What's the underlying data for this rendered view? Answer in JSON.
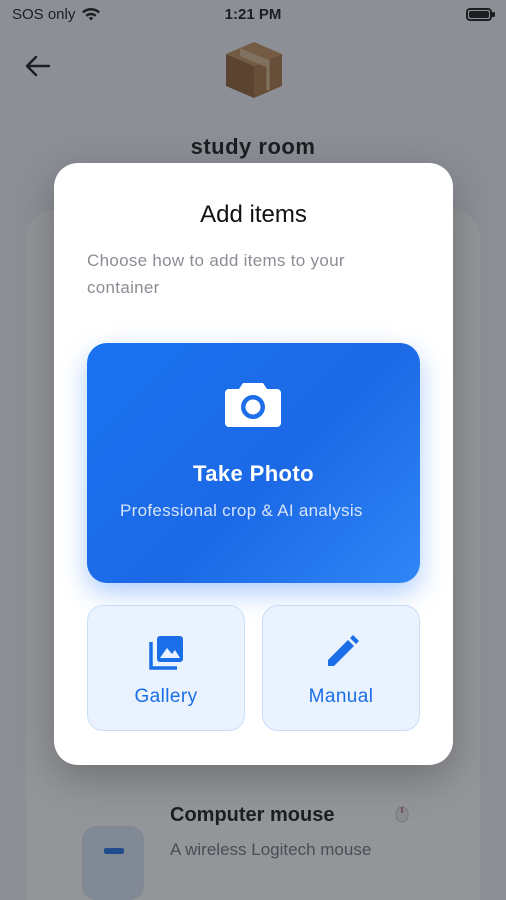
{
  "status_bar": {
    "carrier": "SOS only",
    "time": "1:21 PM"
  },
  "header": {
    "back_icon": "arrow-left-icon",
    "container_icon": "cardboard-box-icon",
    "title": "study room"
  },
  "background_item": {
    "name": "Computer mouse",
    "description": "A wireless Logitech mouse"
  },
  "dialog": {
    "title": "Add items",
    "subtitle": "Choose how to add items to your container",
    "take_photo": {
      "icon": "camera-icon",
      "label": "Take Photo",
      "description": "Professional crop & AI analysis"
    },
    "options": [
      {
        "icon": "gallery-icon",
        "label": "Gallery"
      },
      {
        "icon": "pencil-icon",
        "label": "Manual"
      }
    ]
  },
  "colors": {
    "accent": "#1a73f0",
    "option_bg": "#eaf2fe",
    "option_border": "#c9ddfa"
  }
}
